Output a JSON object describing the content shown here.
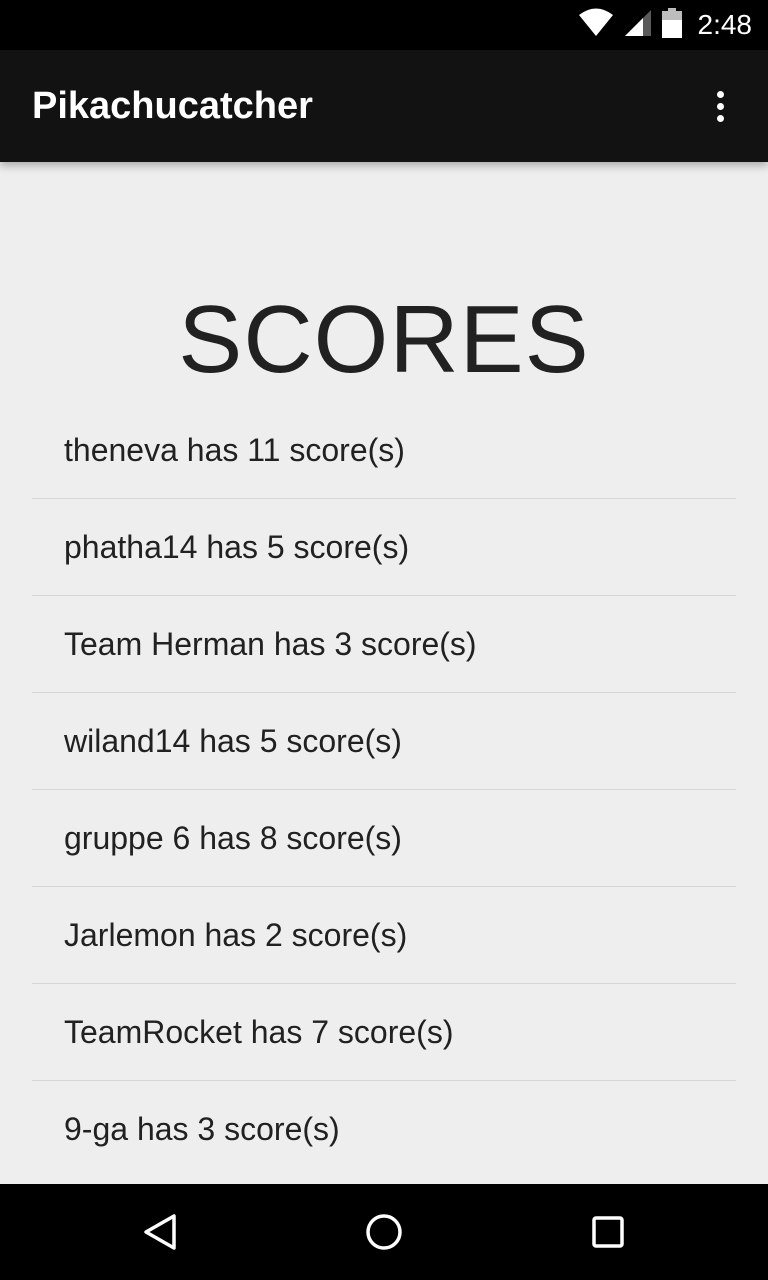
{
  "status_bar": {
    "time": "2:48",
    "icons": [
      "wifi-icon",
      "cell-signal-icon",
      "battery-icon"
    ]
  },
  "app_bar": {
    "title": "Pikachucatcher",
    "overflow_icon": "overflow-menu-icon"
  },
  "main": {
    "heading": "SCORES",
    "scores": [
      "theneva has 11 score(s)",
      "phatha14 has 5 score(s)",
      "Team Herman has 3 score(s)",
      "wiland14 has 5 score(s)",
      "gruppe 6 has 8 score(s)",
      "Jarlemon has 2 score(s)",
      "TeamRocket has 7 score(s)",
      "9-ga has 3 score(s)"
    ]
  },
  "nav_bar": {
    "icons": [
      "back-icon",
      "home-icon",
      "recents-icon"
    ]
  },
  "colors": {
    "status_bar": "#000000",
    "app_bar": "#121212",
    "background": "#eeeeee",
    "text": "#212121",
    "divider": "#d6d6d6"
  }
}
